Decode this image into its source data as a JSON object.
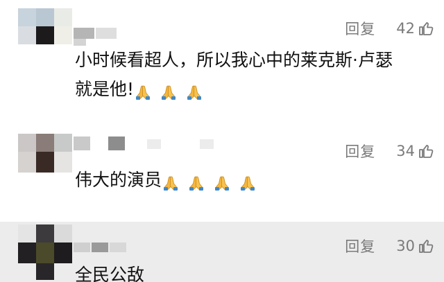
{
  "comments": [
    {
      "reply_label": "回复",
      "likes": "42",
      "text_line1": "小时候看超人，所以我心中的莱克斯·卢瑟",
      "text_line2": "就是他!",
      "emoji_count": 3,
      "emoji_icon": "folded-hands-icon"
    },
    {
      "reply_label": "回复",
      "likes": "34",
      "text_line1": "伟大的演员",
      "emoji_count": 4,
      "emoji_icon": "folded-hands-icon"
    },
    {
      "reply_label": "回复",
      "likes": "30",
      "text_line1": "全民公敌",
      "highlighted": true
    }
  ],
  "colors": {
    "meta_gray": "#7a7a7a",
    "text": "#111111",
    "highlight_bg": "#ececec"
  }
}
